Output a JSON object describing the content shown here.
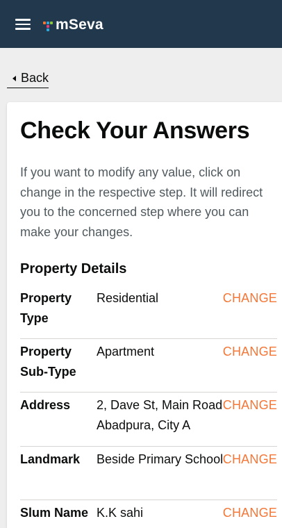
{
  "header": {
    "brand": "mSeva",
    "brand_colors": [
      "#f47738",
      "#2ca8db",
      "#8dc63f",
      "#e63b7a"
    ],
    "bg_color": "#22394d"
  },
  "nav": {
    "back_label": "Back"
  },
  "page": {
    "title": "Check Your Answers",
    "description": "If you want to modify any value, click on change in the respective step. It will redirect you to the concerned step where you can make your changes."
  },
  "section": {
    "title": "Property Details",
    "rows": [
      {
        "key": "Property Type",
        "value": "Residential",
        "action": "CHANGE"
      },
      {
        "key": "Property Sub-Type",
        "value": "Apartment",
        "action": "CHANGE"
      },
      {
        "key": "Address",
        "value": "2, Dave St, Main Road Abadpura, City A",
        "action": "CHANGE"
      },
      {
        "key": "Landmark",
        "value": "Beside Primary School",
        "action": "CHANGE"
      },
      {
        "key": "Slum Name",
        "value": "K.K sahi",
        "action": "CHANGE"
      }
    ]
  },
  "accent_color": "#f47738"
}
